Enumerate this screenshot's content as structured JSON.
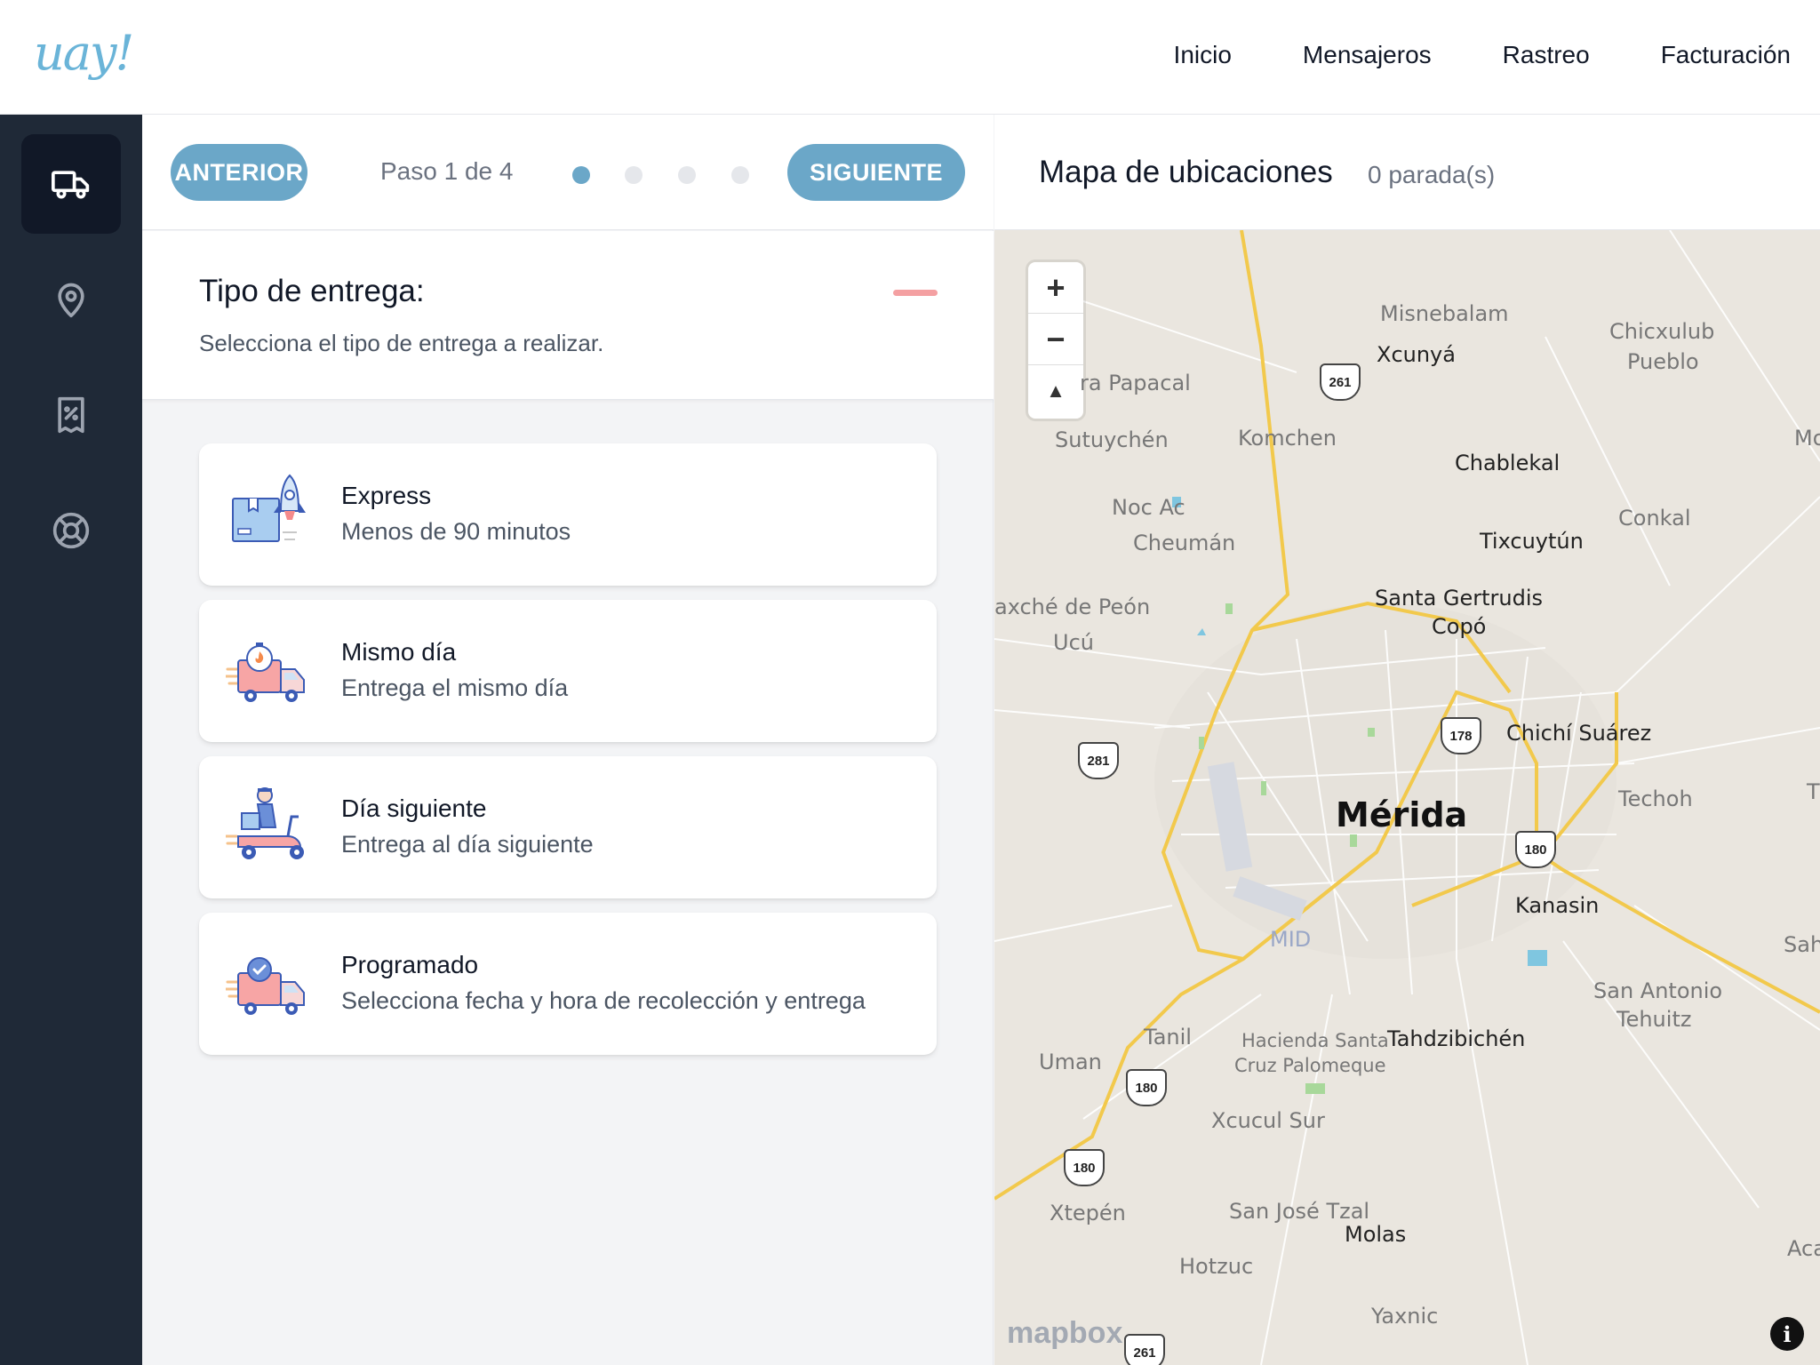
{
  "logo": "uay!",
  "nav": {
    "items": [
      "Inicio",
      "Mensajeros",
      "Rastreo",
      "Facturación"
    ]
  },
  "sidebar": {
    "icons": [
      "truck-icon",
      "location-pin-icon",
      "receipt-icon",
      "lifebuoy-icon"
    ],
    "active_index": 0
  },
  "stepper": {
    "prev_label": "ANTERIOR",
    "next_label": "SIGUIENTE",
    "step_text": "Paso 1 de 4",
    "current_step": 1,
    "total_steps": 4
  },
  "section": {
    "title": "Tipo de entrega:",
    "subtitle": "Selecciona el tipo de entrega a realizar."
  },
  "options": [
    {
      "title": "Express",
      "subtitle": "Menos de 90 minutos",
      "icon": "rocket-box-icon"
    },
    {
      "title": "Mismo día",
      "subtitle": "Entrega el mismo día",
      "icon": "truck-timer-icon"
    },
    {
      "title": "Día siguiente",
      "subtitle": "Entrega al día siguiente",
      "icon": "scooter-courier-icon"
    },
    {
      "title": "Programado",
      "subtitle": "Selecciona fecha y hora de recolección y entrega",
      "icon": "truck-check-icon"
    }
  ],
  "map": {
    "title": "Mapa de ubicaciones",
    "count": "0 parada(s)",
    "attribution": "mapbox",
    "labels": {
      "merida": "Mérida",
      "misnebalam": "Misnebalam",
      "xcunya": "Xcunyá",
      "chicxulub": "Chicxulub",
      "pueblo": "Pueblo",
      "papacal": "ra Papacal",
      "sutuychen": "Sutuychén",
      "komchen": "Komchen",
      "chablekal": "Chablekal",
      "noc_ac": "Noc Ac",
      "conkal": "Conkal",
      "cheuman": "Cheumán",
      "tixcuytun": "Tixcuytún",
      "mo": "Mo",
      "peon": "axché de Peón",
      "santa_gertrudis": "Santa Gertrudis",
      "copo": "Copó",
      "ucu": "Ucú",
      "chichi": "Chichí Suárez",
      "techoh": "Techoh",
      "t": "T",
      "kanasin": "Kanasin",
      "sah": "Sah",
      "mid": "MID",
      "san_antonio": "San Antonio",
      "tehuitz": "Tehuitz",
      "tanil": "Tanil",
      "hacienda": "Hacienda Santa",
      "cruz": "Cruz Palomeque",
      "tahdzibichen": "Tahdzibichén",
      "uman": "Uman",
      "xcucul": "Xcucul Sur",
      "xtepen": "Xtepén",
      "san_jose": "San José Tzal",
      "molas": "Molas",
      "hotzuc": "Hotzuc",
      "yaxnic": "Yaxnic",
      "aca": "Aca"
    },
    "shields": [
      "261",
      "178",
      "281",
      "180",
      "180",
      "180",
      "261"
    ]
  },
  "colors": {
    "accent": "#6ba7c8",
    "sidebar": "#1f2937",
    "collapse": "#f4a0a2",
    "road": "#f2c94c"
  }
}
